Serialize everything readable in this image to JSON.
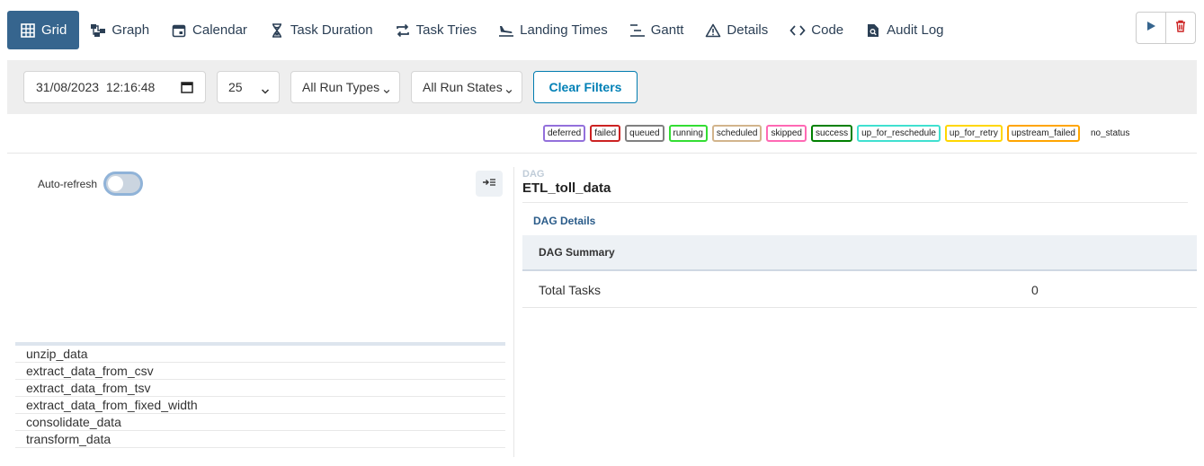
{
  "nav": {
    "tabs": [
      {
        "label": "Grid",
        "icon": "grid-icon"
      },
      {
        "label": "Graph",
        "icon": "graph-icon"
      },
      {
        "label": "Calendar",
        "icon": "calendar-icon"
      },
      {
        "label": "Task Duration",
        "icon": "hourglass-icon"
      },
      {
        "label": "Task Tries",
        "icon": "repeat-icon"
      },
      {
        "label": "Landing Times",
        "icon": "plane-landing-icon"
      },
      {
        "label": "Gantt",
        "icon": "gantt-icon"
      },
      {
        "label": "Details",
        "icon": "warning-icon"
      },
      {
        "label": "Code",
        "icon": "code-icon"
      },
      {
        "label": "Audit Log",
        "icon": "file-search-icon"
      }
    ],
    "active": "Grid"
  },
  "filters": {
    "datetime": "31/08/2023  12:16:48",
    "num_runs": "25",
    "run_types": "All Run Types",
    "run_states": "All Run States",
    "clear_label": "Clear Filters"
  },
  "legend": [
    {
      "label": "deferred",
      "color": "#9370db"
    },
    {
      "label": "failed",
      "color": "#cc2222"
    },
    {
      "label": "queued",
      "color": "#808080"
    },
    {
      "label": "running",
      "color": "#33dd33"
    },
    {
      "label": "scheduled",
      "color": "#d2b48c"
    },
    {
      "label": "skipped",
      "color": "#ff69b4"
    },
    {
      "label": "success",
      "color": "#008000"
    },
    {
      "label": "up_for_reschedule",
      "color": "#40e0d0"
    },
    {
      "label": "up_for_retry",
      "color": "#ffd700"
    },
    {
      "label": "upstream_failed",
      "color": "#ffa500"
    },
    {
      "label": "no_status",
      "color": ""
    }
  ],
  "left": {
    "auto_refresh_label": "Auto-refresh",
    "tasks": [
      "unzip_data",
      "extract_data_from_csv",
      "extract_data_from_tsv",
      "extract_data_from_fixed_width",
      "consolidate_data",
      "transform_data"
    ]
  },
  "right": {
    "dag_label": "DAG",
    "dag_name": "ETL_toll_data",
    "details_label": "DAG Details",
    "summary_title": "DAG Summary",
    "summary_rows": [
      {
        "key": "Total Tasks",
        "value": "0"
      }
    ]
  },
  "colors": {
    "accent": "#36658e",
    "link": "#0180b6"
  }
}
